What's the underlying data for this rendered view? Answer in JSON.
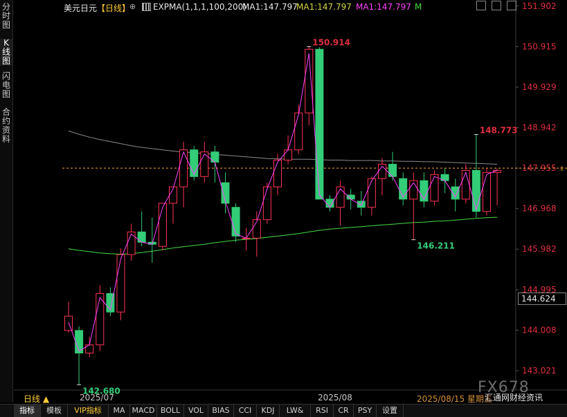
{
  "side_tabs": [
    "分时图",
    "K线图",
    "闪电图",
    "合约资料"
  ],
  "legend": {
    "symbol": "美元日元",
    "period": "【日线】",
    "indicator": "EXPMA(1,1,1,100,200)",
    "ma1": "MA1:147.797",
    "ma2": "MA1:147.797",
    "ma3": "MA1:147.797",
    "m": "M"
  },
  "colors": {
    "up": "#ff3355",
    "down": "#33cc77",
    "ma_fast": "#ff44ff",
    "ma_mid": "#8a8a8a",
    "ma_slow": "#44dd44",
    "axis_text": "#e03040",
    "ref_line": "#ffaa33"
  },
  "chart_data": {
    "type": "candlestick",
    "ylim": [
      142.55,
      152.05
    ],
    "y_ticks": [
      "151.902",
      "150.915",
      "149.929",
      "148.942",
      "147.955",
      "146.968",
      "145.982",
      "144.995",
      "144.008",
      "143.021"
    ],
    "x_ticks": [
      "2025/07",
      "2025/08"
    ],
    "current_price": "144.624",
    "reference_price": 147.955,
    "annotations": {
      "high": "150.914",
      "low": "142.680",
      "recent_high": "148.773",
      "recent_low": "146.211"
    },
    "candles": [
      {
        "o": 144.0,
        "h": 144.7,
        "l": 143.95,
        "c": 144.35
      },
      {
        "o": 144.0,
        "h": 144.1,
        "l": 142.68,
        "c": 143.45
      },
      {
        "o": 143.45,
        "h": 143.85,
        "l": 143.35,
        "c": 143.65
      },
      {
        "o": 143.65,
        "h": 145.1,
        "l": 143.5,
        "c": 144.9
      },
      {
        "o": 144.9,
        "h": 145.05,
        "l": 144.35,
        "c": 144.45
      },
      {
        "o": 144.45,
        "h": 146.0,
        "l": 144.25,
        "c": 145.85
      },
      {
        "o": 145.85,
        "h": 146.6,
        "l": 145.7,
        "c": 146.4
      },
      {
        "o": 146.4,
        "h": 146.9,
        "l": 146.05,
        "c": 146.15
      },
      {
        "o": 146.15,
        "h": 146.75,
        "l": 145.65,
        "c": 146.1
      },
      {
        "o": 146.05,
        "h": 146.7,
        "l": 145.95,
        "c": 147.1
      },
      {
        "o": 147.1,
        "h": 147.5,
        "l": 146.6,
        "c": 147.5
      },
      {
        "o": 147.5,
        "h": 148.6,
        "l": 147.0,
        "c": 148.4
      },
      {
        "o": 148.4,
        "h": 148.5,
        "l": 147.65,
        "c": 147.75
      },
      {
        "o": 147.75,
        "h": 148.6,
        "l": 147.6,
        "c": 148.35
      },
      {
        "o": 148.35,
        "h": 148.5,
        "l": 147.6,
        "c": 148.1
      },
      {
        "o": 147.6,
        "h": 147.85,
        "l": 146.85,
        "c": 147.1
      },
      {
        "o": 147.0,
        "h": 147.1,
        "l": 146.15,
        "c": 146.3
      },
      {
        "o": 146.25,
        "h": 146.5,
        "l": 145.95,
        "c": 146.25
      },
      {
        "o": 146.25,
        "h": 146.9,
        "l": 145.8,
        "c": 146.7
      },
      {
        "o": 146.7,
        "h": 147.6,
        "l": 146.6,
        "c": 147.5
      },
      {
        "o": 147.5,
        "h": 148.3,
        "l": 147.3,
        "c": 148.15
      },
      {
        "o": 148.15,
        "h": 148.75,
        "l": 148.05,
        "c": 148.4
      },
      {
        "o": 148.4,
        "h": 149.5,
        "l": 148.3,
        "c": 149.3
      },
      {
        "o": 149.3,
        "h": 150.914,
        "l": 149.0,
        "c": 150.85
      },
      {
        "o": 150.85,
        "h": 150.9,
        "l": 147.65,
        "c": 147.2
      },
      {
        "o": 147.2,
        "h": 147.3,
        "l": 146.9,
        "c": 147.0
      },
      {
        "o": 147.0,
        "h": 147.65,
        "l": 146.55,
        "c": 147.5
      },
      {
        "o": 147.3,
        "h": 147.45,
        "l": 146.95,
        "c": 147.2
      },
      {
        "o": 147.15,
        "h": 147.4,
        "l": 146.8,
        "c": 147.0
      },
      {
        "o": 147.0,
        "h": 147.75,
        "l": 146.8,
        "c": 147.7
      },
      {
        "o": 147.7,
        "h": 148.2,
        "l": 147.3,
        "c": 148.05
      },
      {
        "o": 148.05,
        "h": 148.35,
        "l": 147.65,
        "c": 147.75
      },
      {
        "o": 147.7,
        "h": 147.85,
        "l": 147.05,
        "c": 147.2
      },
      {
        "o": 147.2,
        "h": 147.85,
        "l": 146.211,
        "c": 147.65
      },
      {
        "o": 147.65,
        "h": 147.85,
        "l": 147.0,
        "c": 147.15
      },
      {
        "o": 147.15,
        "h": 147.9,
        "l": 147.05,
        "c": 147.8
      },
      {
        "o": 147.8,
        "h": 147.95,
        "l": 147.35,
        "c": 147.65
      },
      {
        "o": 147.5,
        "h": 147.7,
        "l": 146.9,
        "c": 147.2
      },
      {
        "o": 147.2,
        "h": 148.05,
        "l": 147.1,
        "c": 147.9
      },
      {
        "o": 147.9,
        "h": 148.773,
        "l": 146.75,
        "c": 146.9
      },
      {
        "o": 146.9,
        "h": 147.95,
        "l": 146.8,
        "c": 147.85
      },
      {
        "o": 147.85,
        "h": 147.95,
        "l": 147.05,
        "c": 147.9
      }
    ],
    "ma_fast": [
      144.2,
      143.5,
      143.65,
      144.8,
      144.5,
      145.75,
      146.35,
      146.15,
      146.1,
      147.0,
      147.45,
      148.35,
      147.8,
      148.3,
      148.1,
      147.15,
      146.35,
      146.25,
      146.65,
      147.45,
      148.1,
      148.4,
      149.25,
      150.75,
      147.3,
      147.0,
      147.45,
      147.2,
      147.05,
      147.65,
      148.0,
      147.75,
      147.25,
      147.6,
      147.2,
      147.75,
      147.65,
      147.25,
      147.85,
      146.95,
      147.8,
      147.9
    ],
    "ma_mid": [
      148.86,
      148.78,
      148.71,
      148.65,
      148.6,
      148.55,
      148.5,
      148.46,
      148.43,
      148.4,
      148.37,
      148.35,
      148.33,
      148.31,
      148.29,
      148.27,
      148.25,
      148.23,
      148.21,
      148.19,
      148.18,
      148.17,
      148.17,
      148.17,
      148.16,
      148.15,
      148.15,
      148.14,
      148.14,
      148.14,
      148.13,
      148.13,
      148.12,
      148.12,
      148.11,
      148.11,
      148.1,
      148.09,
      148.08,
      148.07,
      148.06,
      148.05
    ],
    "ma_slow": [
      145.99,
      145.95,
      145.92,
      145.89,
      145.87,
      145.86,
      145.87,
      145.9,
      145.93,
      145.97,
      146.01,
      146.04,
      146.07,
      146.1,
      146.14,
      146.17,
      146.2,
      146.22,
      146.24,
      146.27,
      146.3,
      146.33,
      146.36,
      146.4,
      146.44,
      146.47,
      146.49,
      146.51,
      146.53,
      146.55,
      146.57,
      146.59,
      146.61,
      146.63,
      146.64,
      146.66,
      146.67,
      146.69,
      146.71,
      146.73,
      146.75,
      146.76
    ]
  },
  "timeline": {
    "period_label": "日线",
    "last_date": "2025/08/15 星期五"
  },
  "watermark": {
    "brand": "FX678",
    "site": "汇通网财经资讯"
  },
  "bottom_tabs": [
    "指标",
    "模板",
    "VIP指标",
    "MA",
    "MACD",
    "BOLL",
    "VOL",
    "BIAS",
    "CCI",
    "KDJ",
    "LW&",
    "RSI",
    "CR",
    "PSY",
    "设置"
  ]
}
